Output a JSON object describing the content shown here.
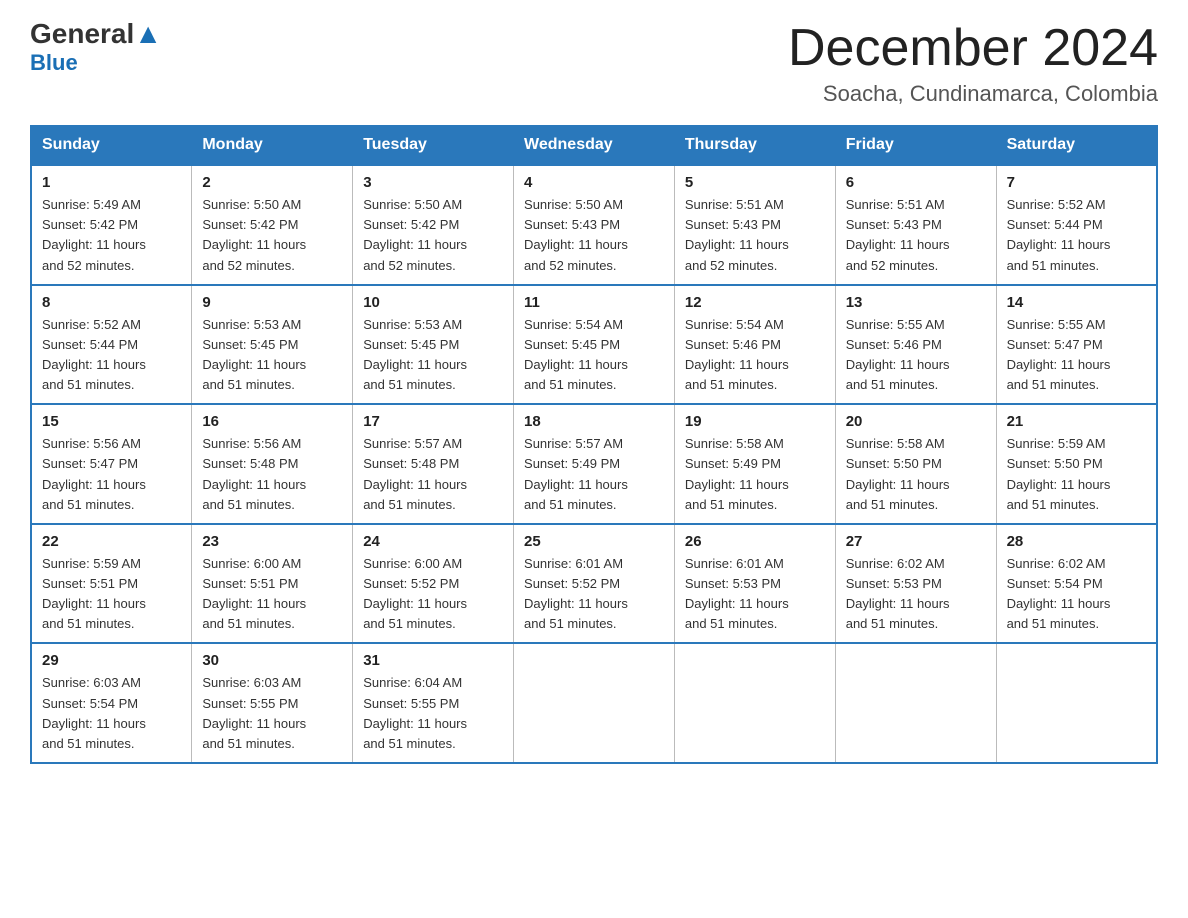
{
  "header": {
    "logo_general": "General",
    "logo_blue": "Blue",
    "title": "December 2024",
    "subtitle": "Soacha, Cundinamarca, Colombia"
  },
  "days_of_week": [
    "Sunday",
    "Monday",
    "Tuesday",
    "Wednesday",
    "Thursday",
    "Friday",
    "Saturday"
  ],
  "weeks": [
    [
      {
        "day": "1",
        "sunrise": "5:49 AM",
        "sunset": "5:42 PM",
        "daylight": "11 hours and 52 minutes."
      },
      {
        "day": "2",
        "sunrise": "5:50 AM",
        "sunset": "5:42 PM",
        "daylight": "11 hours and 52 minutes."
      },
      {
        "day": "3",
        "sunrise": "5:50 AM",
        "sunset": "5:42 PM",
        "daylight": "11 hours and 52 minutes."
      },
      {
        "day": "4",
        "sunrise": "5:50 AM",
        "sunset": "5:43 PM",
        "daylight": "11 hours and 52 minutes."
      },
      {
        "day": "5",
        "sunrise": "5:51 AM",
        "sunset": "5:43 PM",
        "daylight": "11 hours and 52 minutes."
      },
      {
        "day": "6",
        "sunrise": "5:51 AM",
        "sunset": "5:43 PM",
        "daylight": "11 hours and 52 minutes."
      },
      {
        "day": "7",
        "sunrise": "5:52 AM",
        "sunset": "5:44 PM",
        "daylight": "11 hours and 51 minutes."
      }
    ],
    [
      {
        "day": "8",
        "sunrise": "5:52 AM",
        "sunset": "5:44 PM",
        "daylight": "11 hours and 51 minutes."
      },
      {
        "day": "9",
        "sunrise": "5:53 AM",
        "sunset": "5:45 PM",
        "daylight": "11 hours and 51 minutes."
      },
      {
        "day": "10",
        "sunrise": "5:53 AM",
        "sunset": "5:45 PM",
        "daylight": "11 hours and 51 minutes."
      },
      {
        "day": "11",
        "sunrise": "5:54 AM",
        "sunset": "5:45 PM",
        "daylight": "11 hours and 51 minutes."
      },
      {
        "day": "12",
        "sunrise": "5:54 AM",
        "sunset": "5:46 PM",
        "daylight": "11 hours and 51 minutes."
      },
      {
        "day": "13",
        "sunrise": "5:55 AM",
        "sunset": "5:46 PM",
        "daylight": "11 hours and 51 minutes."
      },
      {
        "day": "14",
        "sunrise": "5:55 AM",
        "sunset": "5:47 PM",
        "daylight": "11 hours and 51 minutes."
      }
    ],
    [
      {
        "day": "15",
        "sunrise": "5:56 AM",
        "sunset": "5:47 PM",
        "daylight": "11 hours and 51 minutes."
      },
      {
        "day": "16",
        "sunrise": "5:56 AM",
        "sunset": "5:48 PM",
        "daylight": "11 hours and 51 minutes."
      },
      {
        "day": "17",
        "sunrise": "5:57 AM",
        "sunset": "5:48 PM",
        "daylight": "11 hours and 51 minutes."
      },
      {
        "day": "18",
        "sunrise": "5:57 AM",
        "sunset": "5:49 PM",
        "daylight": "11 hours and 51 minutes."
      },
      {
        "day": "19",
        "sunrise": "5:58 AM",
        "sunset": "5:49 PM",
        "daylight": "11 hours and 51 minutes."
      },
      {
        "day": "20",
        "sunrise": "5:58 AM",
        "sunset": "5:50 PM",
        "daylight": "11 hours and 51 minutes."
      },
      {
        "day": "21",
        "sunrise": "5:59 AM",
        "sunset": "5:50 PM",
        "daylight": "11 hours and 51 minutes."
      }
    ],
    [
      {
        "day": "22",
        "sunrise": "5:59 AM",
        "sunset": "5:51 PM",
        "daylight": "11 hours and 51 minutes."
      },
      {
        "day": "23",
        "sunrise": "6:00 AM",
        "sunset": "5:51 PM",
        "daylight": "11 hours and 51 minutes."
      },
      {
        "day": "24",
        "sunrise": "6:00 AM",
        "sunset": "5:52 PM",
        "daylight": "11 hours and 51 minutes."
      },
      {
        "day": "25",
        "sunrise": "6:01 AM",
        "sunset": "5:52 PM",
        "daylight": "11 hours and 51 minutes."
      },
      {
        "day": "26",
        "sunrise": "6:01 AM",
        "sunset": "5:53 PM",
        "daylight": "11 hours and 51 minutes."
      },
      {
        "day": "27",
        "sunrise": "6:02 AM",
        "sunset": "5:53 PM",
        "daylight": "11 hours and 51 minutes."
      },
      {
        "day": "28",
        "sunrise": "6:02 AM",
        "sunset": "5:54 PM",
        "daylight": "11 hours and 51 minutes."
      }
    ],
    [
      {
        "day": "29",
        "sunrise": "6:03 AM",
        "sunset": "5:54 PM",
        "daylight": "11 hours and 51 minutes."
      },
      {
        "day": "30",
        "sunrise": "6:03 AM",
        "sunset": "5:55 PM",
        "daylight": "11 hours and 51 minutes."
      },
      {
        "day": "31",
        "sunrise": "6:04 AM",
        "sunset": "5:55 PM",
        "daylight": "11 hours and 51 minutes."
      },
      null,
      null,
      null,
      null
    ]
  ],
  "labels": {
    "sunrise": "Sunrise:",
    "sunset": "Sunset:",
    "daylight": "Daylight:"
  }
}
